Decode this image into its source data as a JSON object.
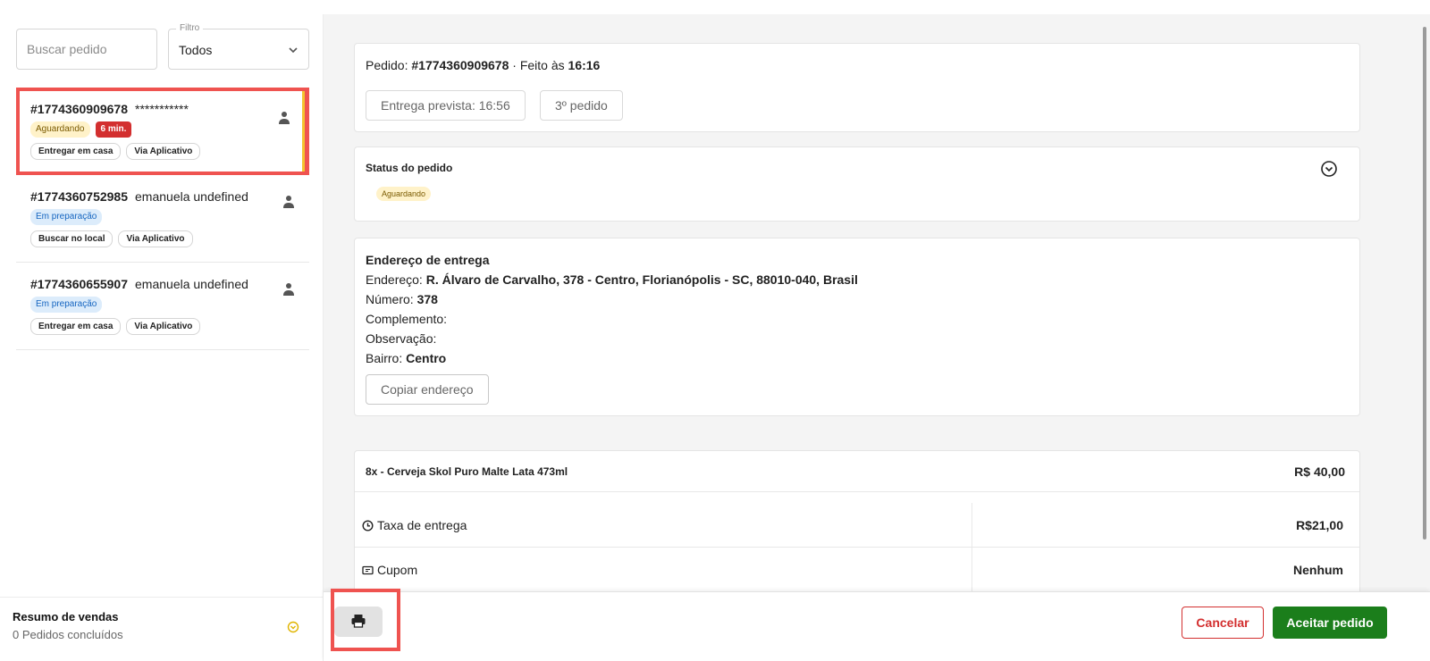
{
  "sidebar": {
    "search": {
      "placeholder": "Buscar pedido"
    },
    "filter": {
      "label": "Filtro",
      "value": "Todos"
    },
    "orders": [
      {
        "id": "#1774360909678",
        "customer": "***********",
        "status": "Aguardando",
        "time": "6 min.",
        "delivery": "Entregar em casa",
        "channel": "Via Aplicativo"
      },
      {
        "id": "#1774360752985",
        "customer": "emanuela undefined",
        "status": "Em preparação",
        "delivery": "Buscar no local",
        "channel": "Via Aplicativo"
      },
      {
        "id": "#1774360655907",
        "customer": "emanuela undefined",
        "status": "Em preparação",
        "delivery": "Entregar em casa",
        "channel": "Via Aplicativo"
      }
    ],
    "summary": {
      "title": "Resumo de vendas",
      "subtitle": "0 Pedidos concluídos"
    }
  },
  "main": {
    "order": {
      "label": "Pedido:",
      "id": "#1774360909678",
      "separator": "· Feito às",
      "time": "16:16",
      "eta": "Entrega prevista: 16:56",
      "count": "3º pedido"
    },
    "status": {
      "title": "Status do pedido",
      "badge": "Aguardando"
    },
    "address": {
      "title": "Endereço de entrega",
      "address_label": "Endereço:",
      "address_value": "R. Álvaro de Carvalho, 378 - Centro, Florianópolis - SC, 88010-040, Brasil",
      "number_label": "Número:",
      "number_value": "378",
      "complement_label": "Complemento:",
      "complement_value": "",
      "note_label": "Observação:",
      "note_value": "",
      "district_label": "Bairro:",
      "district_value": "Centro",
      "copy_label": "Copiar endereço"
    },
    "items": [
      {
        "name": "8x - Cerveja Skol Puro Malte Lata 473ml",
        "price": "R$ 40,00"
      }
    ],
    "fees": {
      "delivery_label": "Taxa de entrega",
      "delivery_value": "R$21,00",
      "coupon_label": "Cupom",
      "coupon_value": "Nenhum"
    }
  },
  "footer": {
    "cancel_label": "Cancelar",
    "accept_label": "Aceitar pedido"
  },
  "colors": {
    "accent": "#1b7e1b",
    "danger": "#d32f2f",
    "waiting_bg": "#fff2c9",
    "prep_bg": "#dcecfb"
  },
  "icons": {
    "user": "person-icon",
    "print": "printer-icon",
    "expand": "chevron-circle-icon",
    "chevron": "chevron-down-icon",
    "clock": "clock-icon",
    "coupon": "ticket-icon"
  }
}
